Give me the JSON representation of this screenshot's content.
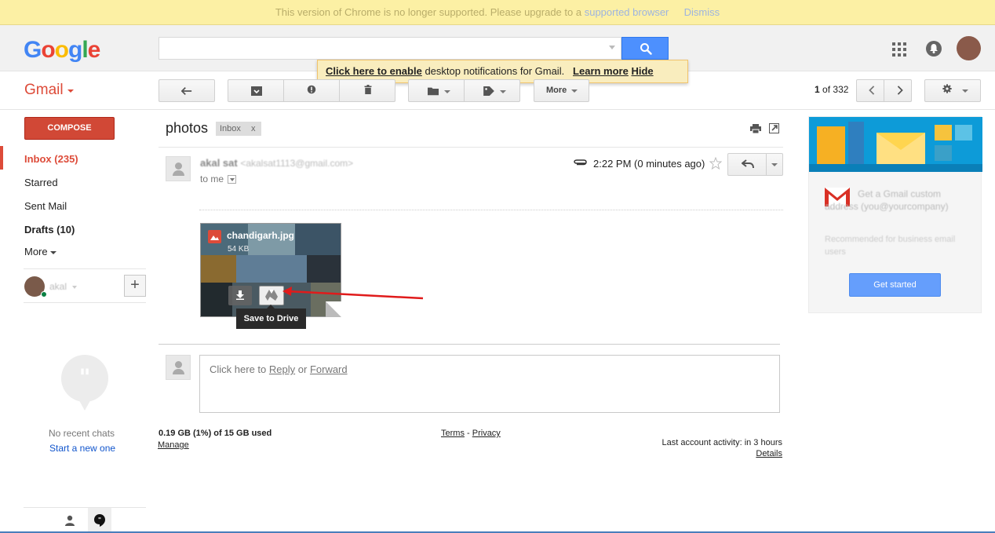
{
  "banner": {
    "text": "This version of Chrome is no longer supported. Please upgrade to a",
    "link": "supported browser",
    "dismiss": "Dismiss"
  },
  "logo": {
    "letters": [
      "G",
      "o",
      "o",
      "g",
      "l",
      "e"
    ],
    "colors": [
      "#4285f4",
      "#ea4335",
      "#fbbc05",
      "#4285f4",
      "#34a853",
      "#ea4335"
    ]
  },
  "search": {
    "value": ""
  },
  "notification": {
    "enable_link": "Click here to enable",
    "text": "desktop notifications for Gmail.",
    "learn_more": "Learn more",
    "hide": "Hide"
  },
  "app": {
    "label": "Gmail"
  },
  "toolbar": {
    "more_label": "More",
    "pager_current": "1",
    "pager_of": "of",
    "pager_total": "332"
  },
  "sidebar": {
    "compose_label": "COMPOSE",
    "inbox": "Inbox (235)",
    "starred": "Starred",
    "sent": "Sent Mail",
    "drafts": "Drafts (10)",
    "more": "More",
    "hangout_user": "akal",
    "no_chats": "No recent chats",
    "start_new": "Start a new one"
  },
  "thread": {
    "subject": "photos",
    "tag": "Inbox",
    "tag_close": "x",
    "sender_name": "akal sat",
    "sender_email": "<akalsat1113@gmail.com>",
    "recipient": "to me",
    "time": "2:22 PM (0 minutes ago)",
    "attachment": {
      "filename": "chandigarh.jpg",
      "size": "54 KB",
      "tooltip": "Save to Drive"
    },
    "reply_prefix": "Click here to",
    "reply_link": "Reply",
    "reply_or": "or",
    "forward_link": "Forward"
  },
  "footer": {
    "storage": "0.19 GB (1%) of 15 GB used",
    "manage": "Manage",
    "terms": "Terms",
    "sep": "-",
    "privacy": "Privacy",
    "activity": "Last account activity: in 3 hours",
    "details": "Details"
  },
  "ad": {
    "title": "Get a Gmail custom address (you@yourcompany)",
    "subtitle": "Recommended for business email users",
    "button": "Get started"
  },
  "colors": {
    "accent_red": "#dd4b39",
    "accent_blue": "#4d90fe",
    "banner": "#fcf0a4"
  }
}
